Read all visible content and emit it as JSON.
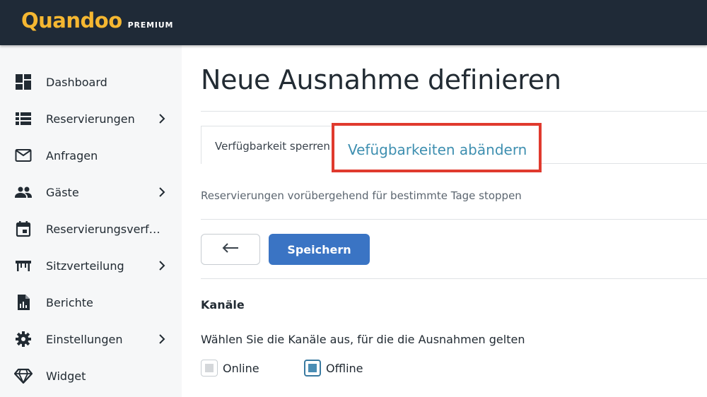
{
  "header": {
    "logo_text": "Quandoo",
    "logo_badge": "PREMIUM"
  },
  "sidebar": {
    "items": [
      {
        "label": "Dashboard",
        "icon": "dashboard-icon",
        "has_chevron": false
      },
      {
        "label": "Reservierungen",
        "icon": "list-icon",
        "has_chevron": true
      },
      {
        "label": "Anfragen",
        "icon": "mail-icon",
        "has_chevron": false
      },
      {
        "label": "Gäste",
        "icon": "people-icon",
        "has_chevron": true
      },
      {
        "label": "Reservierungsverfügbarkeit",
        "icon": "calendar-icon",
        "has_chevron": false
      },
      {
        "label": "Sitzverteilung",
        "icon": "table-icon",
        "has_chevron": true
      },
      {
        "label": "Berichte",
        "icon": "report-icon",
        "has_chevron": false
      },
      {
        "label": "Einstellungen",
        "icon": "gear-icon",
        "has_chevron": true
      },
      {
        "label": "Widget",
        "icon": "diamond-icon",
        "has_chevron": false
      }
    ]
  },
  "main": {
    "title": "Neue Ausnahme definieren",
    "tabs": [
      {
        "label": "Verfügbarkeit sperren",
        "active": true
      },
      {
        "label": "Vefügbarkeiten abändern",
        "highlighted": true
      }
    ],
    "description": "Reservierungen vorübergehend für bestimmte Tage stoppen",
    "back_icon": "arrow-left-icon",
    "save_label": "Speichern",
    "channels": {
      "title": "Kanäle",
      "description": "Wählen Sie die Kanäle aus, für die die Ausnahmen gelten",
      "options": [
        {
          "label": "Online",
          "checked": false
        },
        {
          "label": "Offline",
          "checked": true
        }
      ]
    }
  },
  "colors": {
    "topbar": "#1f2a37",
    "logo": "#f5b731",
    "primary_button": "#3a74c4",
    "highlight_border": "#e03a2e",
    "link_text": "#3e8fb0"
  }
}
